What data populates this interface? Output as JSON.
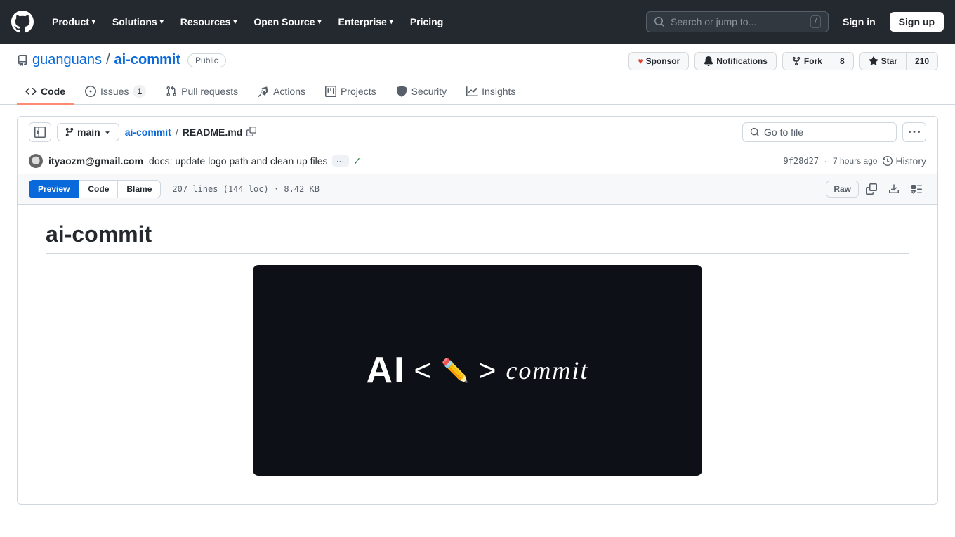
{
  "nav": {
    "items": [
      {
        "label": "Product",
        "id": "product"
      },
      {
        "label": "Solutions",
        "id": "solutions"
      },
      {
        "label": "Resources",
        "id": "resources"
      },
      {
        "label": "Open Source",
        "id": "open-source"
      },
      {
        "label": "Enterprise",
        "id": "enterprise"
      },
      {
        "label": "Pricing",
        "id": "pricing"
      }
    ],
    "search_placeholder": "Search or jump to...",
    "search_shortcut": "/",
    "signin_label": "Sign in",
    "signup_label": "Sign up"
  },
  "repo": {
    "owner": "guanguans",
    "owner_url": "#",
    "repo_name": "ai-commit",
    "visibility": "Public",
    "tabs": [
      {
        "label": "Code",
        "icon": "code-icon",
        "active": true
      },
      {
        "label": "Issues",
        "icon": "issues-icon",
        "count": "1"
      },
      {
        "label": "Pull requests",
        "icon": "pr-icon"
      },
      {
        "label": "Actions",
        "icon": "actions-icon"
      },
      {
        "label": "Projects",
        "icon": "projects-icon"
      },
      {
        "label": "Security",
        "icon": "security-icon"
      },
      {
        "label": "Insights",
        "icon": "insights-icon"
      }
    ],
    "actions": {
      "sponsor_label": "Sponsor",
      "notifications_label": "Notifications",
      "fork_label": "Fork",
      "fork_count": "8",
      "star_label": "Star",
      "star_count": "210"
    }
  },
  "file_header": {
    "branch": "main",
    "path_owner": "ai-commit",
    "path_file": "README.md",
    "goto_placeholder": "Go to file",
    "sidebar_icon": "sidebar-icon",
    "more_options_icon": "more-options-icon"
  },
  "commit": {
    "author": "ityaozm@gmail.com",
    "message": "docs: update logo path and clean up files",
    "hash": "9f28d27",
    "time": "7 hours ago",
    "history_label": "History",
    "expand_label": "···"
  },
  "file_controls": {
    "view_tabs": [
      {
        "label": "Preview",
        "active": true
      },
      {
        "label": "Code",
        "active": false
      },
      {
        "label": "Blame",
        "active": false
      }
    ],
    "stats": "207 lines (144 loc) · 8.42 KB",
    "raw_label": "Raw"
  },
  "readme": {
    "title": "ai-commit",
    "image_alt": "ai-commit logo"
  }
}
